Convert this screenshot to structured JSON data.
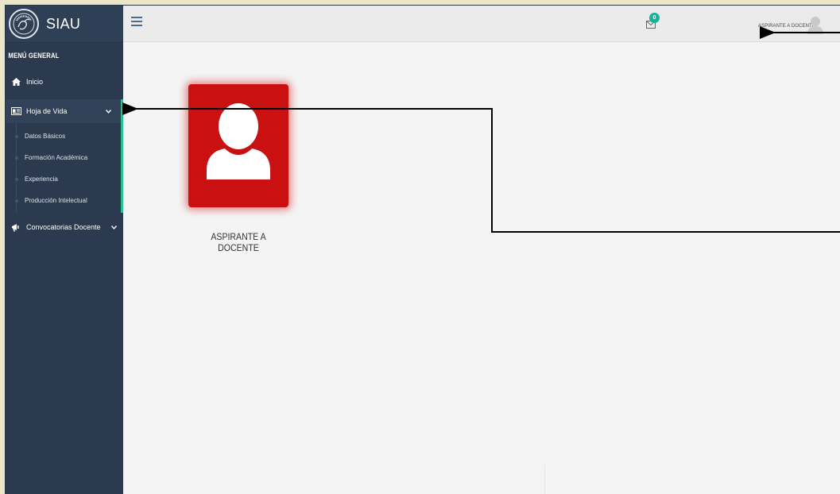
{
  "brand": {
    "name": "SIAU",
    "logo_icon": "university-seal-icon"
  },
  "sidebar": {
    "header": "MENÚ GENERAL",
    "items": [
      {
        "label": "Inicio",
        "icon": "home-icon"
      },
      {
        "label": "Hoja de Vida",
        "icon": "id-card-icon",
        "expanded": true,
        "children": [
          "Datos Básicos",
          "Formación Académica",
          "Experiencia",
          "Producción Intelectual"
        ]
      },
      {
        "label": "Convocatorias Docente",
        "icon": "megaphone-icon"
      }
    ]
  },
  "topbar": {
    "notifications": {
      "count": "0",
      "icon": "envelope-icon"
    },
    "user": {
      "name": "ASPIRANTE A DOCENTE",
      "icon": "user-avatar-icon"
    }
  },
  "main": {
    "role_card": {
      "label": "ASPIRANTE A DOCENTE",
      "icon": "user-silhouette-icon"
    }
  },
  "colors": {
    "sidebar": "#2b3a4f",
    "accent": "#27c28f",
    "card": "#c91111",
    "badge": "#14b39b",
    "page_border": "#ece6c9"
  }
}
